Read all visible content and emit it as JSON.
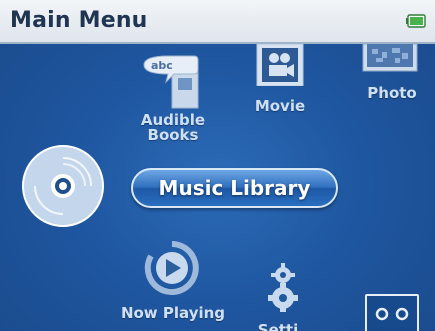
{
  "header": {
    "title": "Main Menu",
    "battery_icon": "battery-icon",
    "battery_color": "#47b34a"
  },
  "menu": {
    "audible_books": {
      "label_line1": "Audible",
      "label_line2": "Books",
      "icon": "audible-books-icon"
    },
    "movie": {
      "label": "Movie",
      "icon": "movie-icon"
    },
    "photo": {
      "label": "Photo",
      "icon": "photo-icon"
    },
    "music_library": {
      "label": "Music Library",
      "icon": "cd-icon"
    },
    "now_playing": {
      "label": "Now Playing",
      "icon": "play-icon"
    },
    "settings": {
      "label": "Setti",
      "icon": "gear-icon"
    },
    "corner_button": {
      "icon": "dual-circle-icon"
    }
  },
  "colors": {
    "background": "#1f57a1",
    "selected_pill": "#2f6fbe",
    "label": "#cfe0f5"
  }
}
